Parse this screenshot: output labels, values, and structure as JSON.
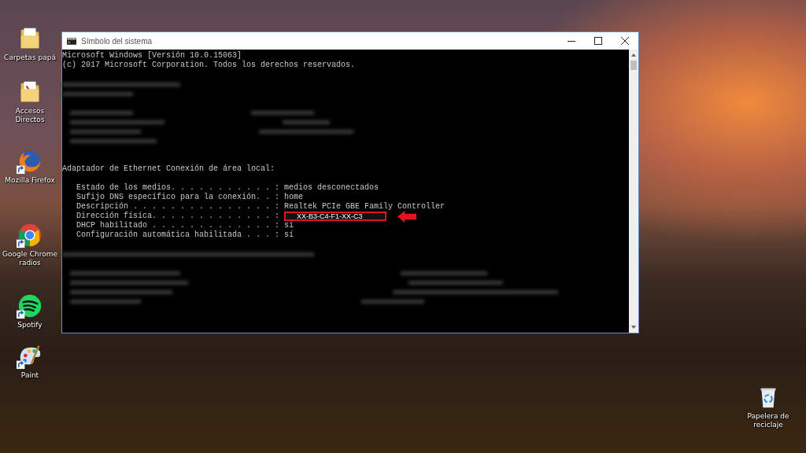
{
  "desktop_icons": [
    {
      "kind": "folder",
      "label": "Carpetas papá",
      "shortcut": false
    },
    {
      "kind": "pdf-folder",
      "label": "Accesos Directos",
      "shortcut": false
    },
    {
      "kind": "firefox",
      "label": "Mozilla Firefox",
      "shortcut": true
    },
    {
      "kind": "chrome",
      "label": "Google Chrome radios",
      "shortcut": true
    },
    {
      "kind": "spotify",
      "label": "Spotify",
      "shortcut": true
    },
    {
      "kind": "paint",
      "label": "Paint",
      "shortcut": true
    },
    {
      "kind": "recycle-bin",
      "label": "Papelera de reciclaje",
      "shortcut": false
    }
  ],
  "window": {
    "title": "Símbolo del sistema",
    "header_lines": [
      "Microsoft Windows [Versión 10.0.15063]",
      "(c) 2017 Microsoft Corporation. Todos los derechos reservados."
    ],
    "adapter_heading": "Adaptador de Ethernet Conexión de área local:",
    "entries": [
      {
        "label": "Estado de los medios. . . . . . . . . . . :",
        "value": "medios desconectados",
        "highlighted": false
      },
      {
        "label": "Sufijo DNS específico para la conexión. . :",
        "value": "home",
        "highlighted": false
      },
      {
        "label": "Descripción . . . . . . . . . . . . . . . :",
        "value": "Realtek PCIe GBE Family Controller",
        "highlighted": false
      },
      {
        "label": "Dirección física. . . . . . . . . . . . . :",
        "value": "XX-B3-C4-F1-XX-C3",
        "highlighted": true
      },
      {
        "label": "DHCP habilitado . . . . . . . . . . . . . :",
        "value": "sí",
        "highlighted": false
      },
      {
        "label": "Configuración automática habilitada . . . :",
        "value": "sí",
        "highlighted": false
      }
    ]
  }
}
